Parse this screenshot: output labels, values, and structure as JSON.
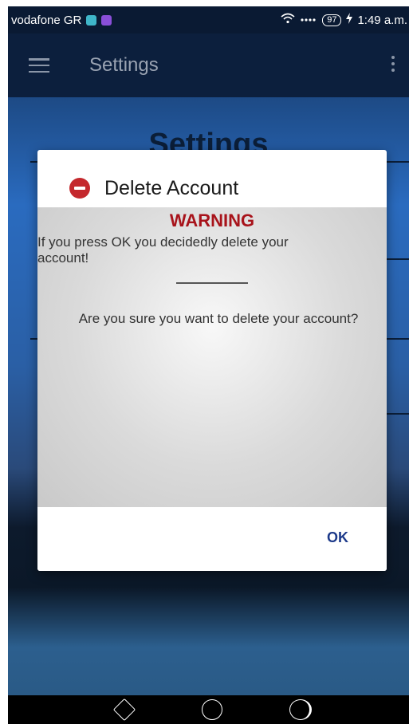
{
  "status_bar": {
    "carrier": "vodafone GR",
    "battery": "97",
    "time": "1:49 a.m."
  },
  "app_bar": {
    "title": "Settings"
  },
  "background": {
    "heading": "Settings"
  },
  "dialog": {
    "title": "Delete Account",
    "warning_heading": "WARNING",
    "warning_text": "If you press OK you decidedly delete your account!",
    "question": "Are you sure you want to delete your account?",
    "ok_label": "OK"
  },
  "icons": {
    "menu": "hamburger-menu-icon",
    "more": "more-vert-icon",
    "stop": "stop-sign-icon",
    "nav_back": "nav-back-icon",
    "nav_home": "nav-home-icon",
    "nav_recent": "nav-recent-icon"
  },
  "colors": {
    "warning": "#a8131b",
    "ok_button": "#1d3a8a",
    "stop_icon": "#c4282d"
  }
}
